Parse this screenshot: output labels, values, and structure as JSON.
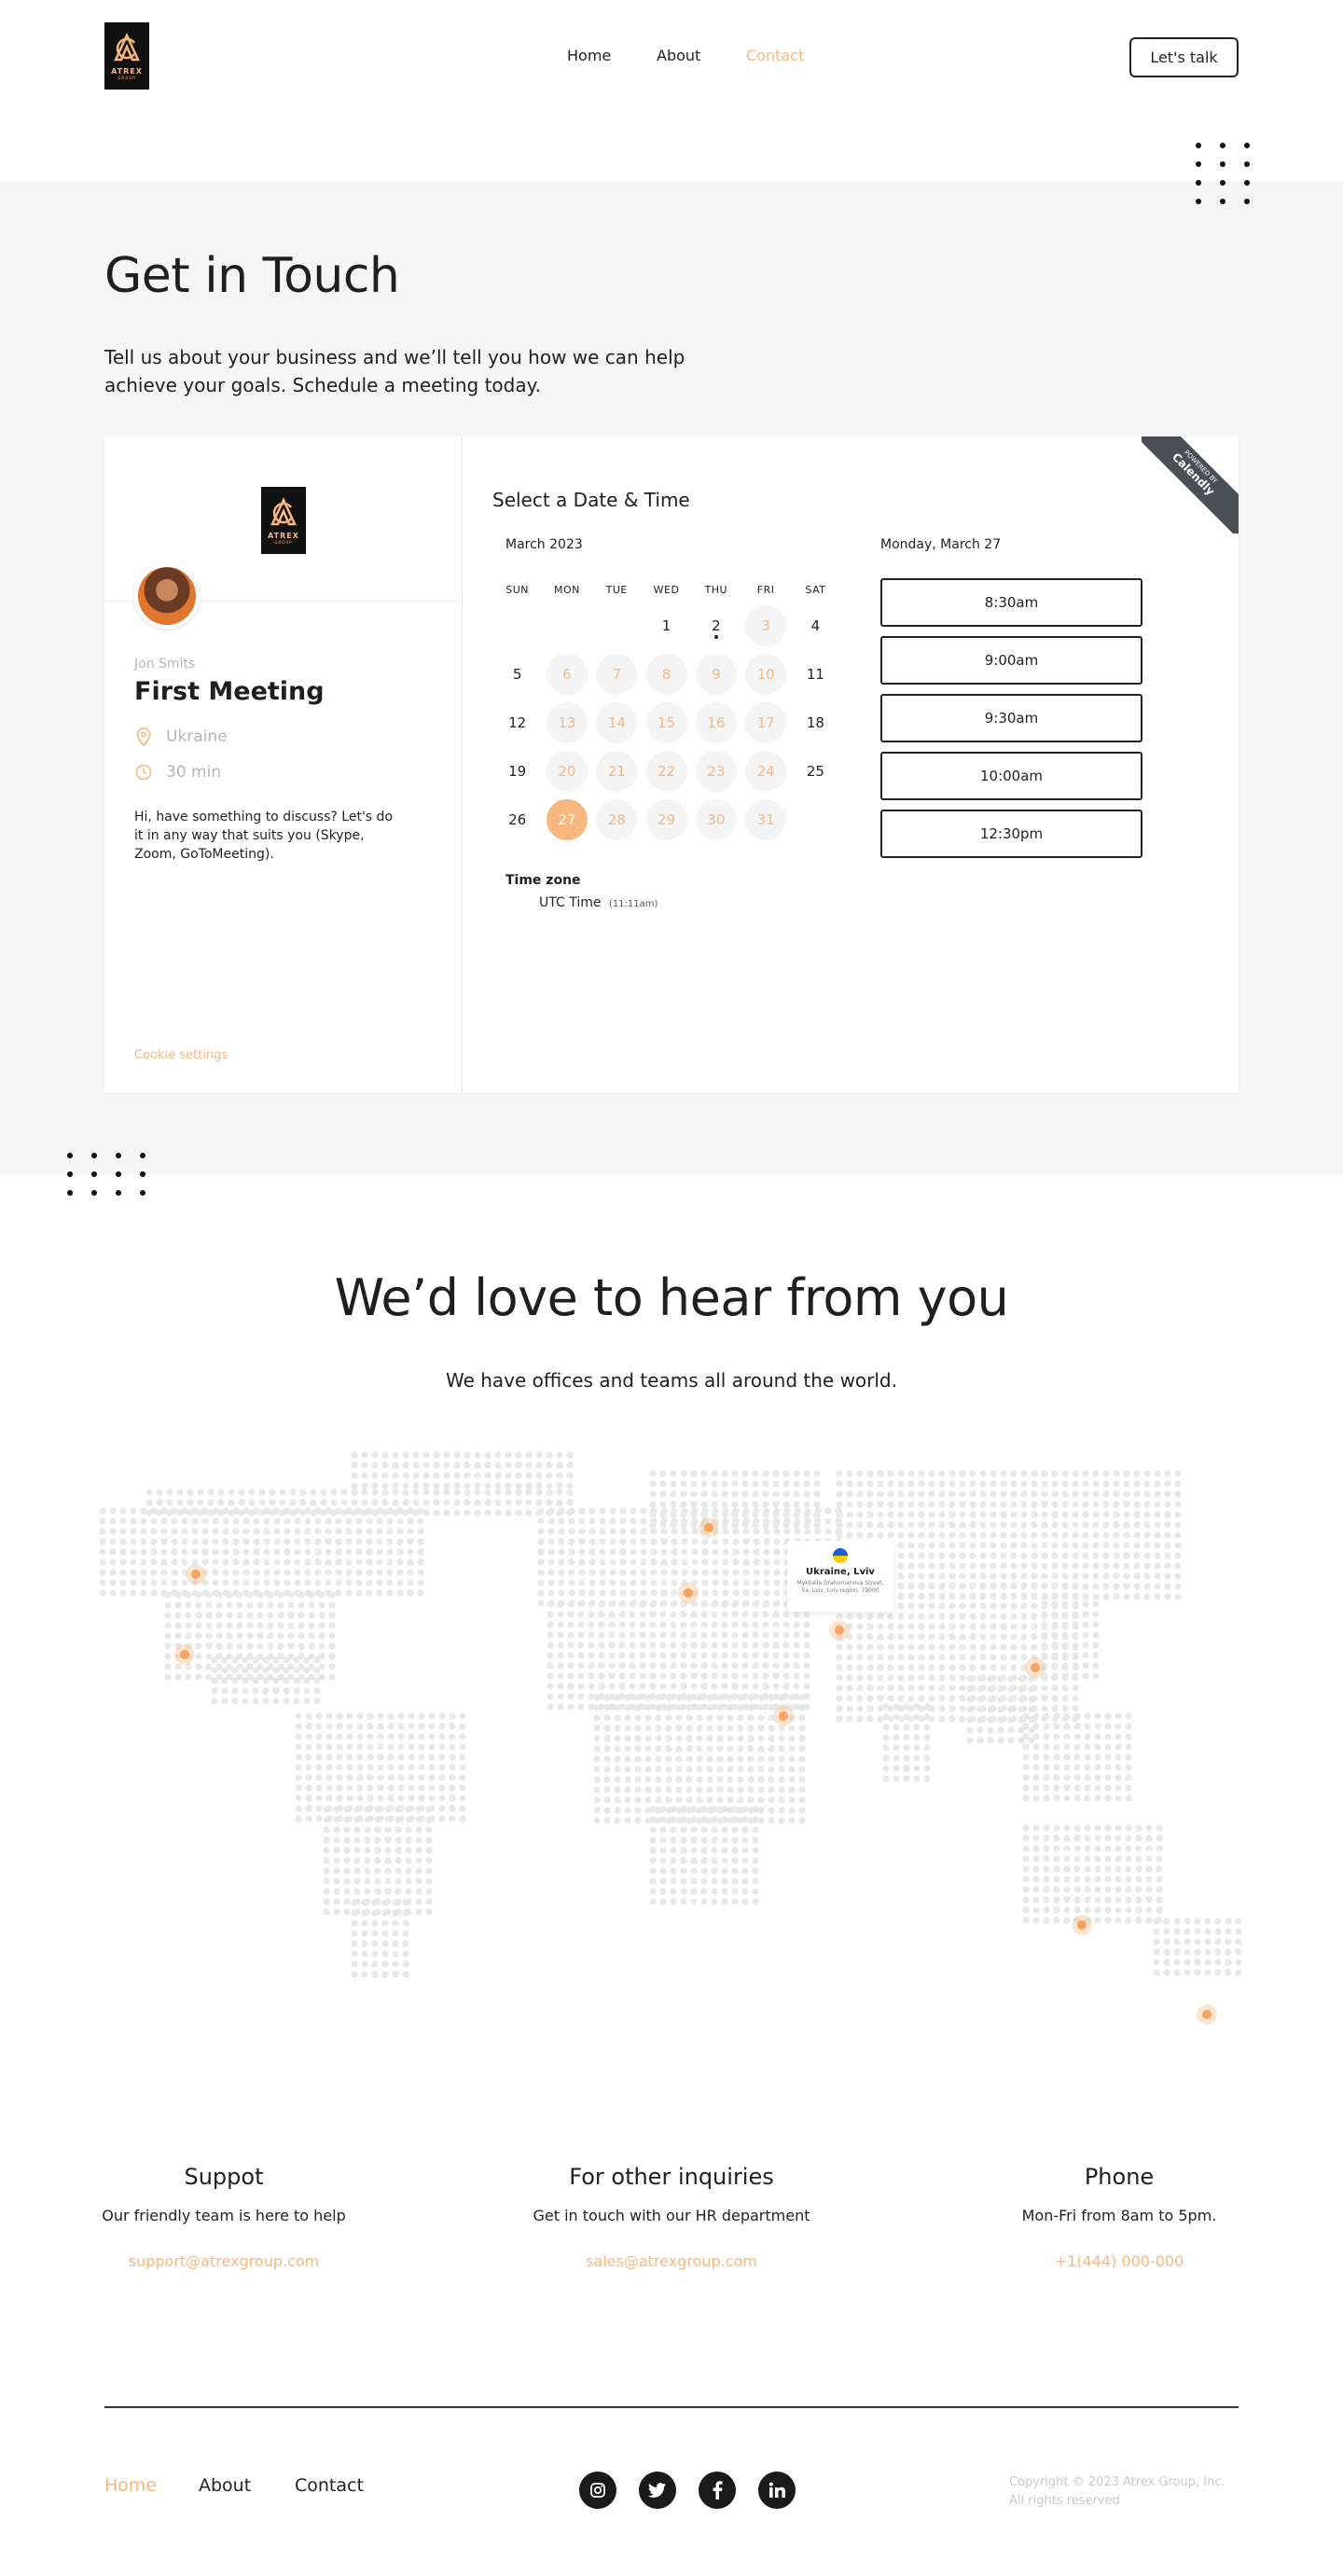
{
  "header": {
    "logo": {
      "brand": "ATREX",
      "sub": "GROUP"
    },
    "nav": [
      {
        "label": "Home"
      },
      {
        "label": "About"
      },
      {
        "label": "Contact"
      }
    ],
    "cta": "Let's talk"
  },
  "touch": {
    "title": "Get in Touch",
    "subtitle": "Tell us about your business and we’ll tell you how we can help achieve your goals. Schedule a meeting today."
  },
  "booking": {
    "host": "Jon Smits",
    "event_title": "First Meeting",
    "location": "Ukraine",
    "duration": "30 min",
    "description": "Hi, have something to discuss? Let's do it in any way that suits you (Skype, Zoom, GoToMeeting).",
    "cookie_settings": "Cookie settings",
    "select_title": "Select a Date & Time",
    "month": "March 2023",
    "weekdays": [
      "SUN",
      "MON",
      "TUE",
      "WED",
      "THU",
      "FRI",
      "SAT"
    ],
    "days": [
      {
        "d": "",
        "state": "empty"
      },
      {
        "d": "",
        "state": "empty"
      },
      {
        "d": "",
        "state": "empty"
      },
      {
        "d": "1",
        "state": "plain"
      },
      {
        "d": "2",
        "state": "today"
      },
      {
        "d": "3",
        "state": "av"
      },
      {
        "d": "4",
        "state": "plain"
      },
      {
        "d": "5",
        "state": "plain"
      },
      {
        "d": "6",
        "state": "av"
      },
      {
        "d": "7",
        "state": "av"
      },
      {
        "d": "8",
        "state": "av"
      },
      {
        "d": "9",
        "state": "av"
      },
      {
        "d": "10",
        "state": "av"
      },
      {
        "d": "11",
        "state": "plain"
      },
      {
        "d": "12",
        "state": "plain"
      },
      {
        "d": "13",
        "state": "av"
      },
      {
        "d": "14",
        "state": "av"
      },
      {
        "d": "15",
        "state": "av"
      },
      {
        "d": "16",
        "state": "av"
      },
      {
        "d": "17",
        "state": "av"
      },
      {
        "d": "18",
        "state": "plain"
      },
      {
        "d": "19",
        "state": "plain"
      },
      {
        "d": "20",
        "state": "av"
      },
      {
        "d": "21",
        "state": "av"
      },
      {
        "d": "22",
        "state": "av"
      },
      {
        "d": "23",
        "state": "av"
      },
      {
        "d": "24",
        "state": "av"
      },
      {
        "d": "25",
        "state": "plain"
      },
      {
        "d": "26",
        "state": "plain"
      },
      {
        "d": "27",
        "state": "sel"
      },
      {
        "d": "28",
        "state": "av"
      },
      {
        "d": "29",
        "state": "av"
      },
      {
        "d": "30",
        "state": "av"
      },
      {
        "d": "31",
        "state": "av"
      }
    ],
    "timezone_label": "Time zone",
    "timezone": "UTC Time",
    "timezone_time": "(11:11am)",
    "selected_day": "Monday, March 27",
    "slots": [
      "8:30am",
      "9:00am",
      "9:30am",
      "10:00am",
      "12:30pm"
    ],
    "ribbon_small": "POWERED BY",
    "ribbon_brand": "Calendly"
  },
  "love": {
    "title": "We’d love to hear from you",
    "subtitle": "We have offices and teams all around the world.",
    "map_card": {
      "city": "Ukraine, Lviv",
      "address": "Mykhaila Drahomanova Street, 5a, Lviv, Lviv region, 79000"
    }
  },
  "contacts": [
    {
      "title": "Suppot",
      "desc": "Our friendly team is here to help",
      "link": "support@atrexgroup.com"
    },
    {
      "title": "For other inquiries",
      "desc": "Get in touch with our HR department",
      "link": "sales@atrexgroup.com"
    },
    {
      "title": "Phone",
      "desc": "Mon-Fri from 8am to 5pm.",
      "link": "+1(444) 000-000"
    }
  ],
  "footer": {
    "nav": [
      "Home",
      "About",
      "Contact"
    ],
    "social": [
      "instagram-icon",
      "twitter-icon",
      "facebook-icon",
      "linkedin-icon"
    ],
    "copyright": "Copyright © 2023 Atrex Group, Inc.",
    "rights": "All rights reserved"
  },
  "colors": {
    "accent": "#f7b77f",
    "dark": "#1f1f1f",
    "section_bg": "#f5f5f5"
  }
}
